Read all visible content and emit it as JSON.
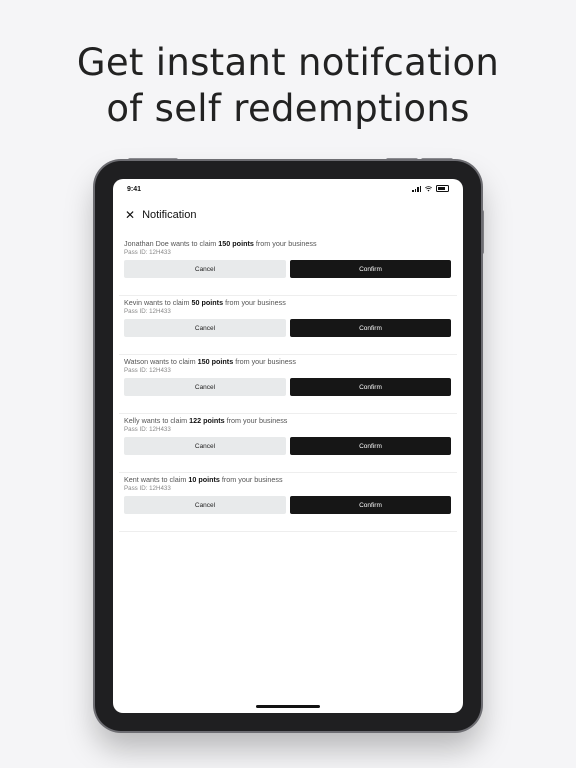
{
  "headline": {
    "line1": "Get instant notifcation",
    "line2": "of self redemptions"
  },
  "status_bar": {
    "time": "9:41"
  },
  "nav": {
    "title": "Notification"
  },
  "notifications": [
    {
      "prefix": "Jonathan Doe wants to claim ",
      "points": "150 points",
      "suffix": " from your business",
      "pass": "Pass ID: 12H433",
      "cancel": "Cancel",
      "confirm": "Confirm"
    },
    {
      "prefix": "Kevin wants to claim ",
      "points": "50 points",
      "suffix": " from your business",
      "pass": "Pass ID: 12H433",
      "cancel": "Cancel",
      "confirm": "Confirm"
    },
    {
      "prefix": "Watson wants to claim ",
      "points": "150 points",
      "suffix": " from your business",
      "pass": "Pass ID: 12H433",
      "cancel": "Cancel",
      "confirm": "Confirm"
    },
    {
      "prefix": "Kelly wants to claim ",
      "points": "122 points",
      "suffix": " from your business",
      "pass": "Pass ID: 12H433",
      "cancel": "Cancel",
      "confirm": "Confirm"
    },
    {
      "prefix": "Kent wants to claim ",
      "points": "10 points",
      "suffix": " from your business",
      "pass": "Pass ID: 12H433",
      "cancel": "Cancel",
      "confirm": "Confirm"
    }
  ],
  "icons": {
    "close": "close-icon",
    "signal": "cellular-signal-icon",
    "wifi": "wifi-icon",
    "battery": "battery-icon"
  },
  "colors": {
    "background": "#f5f5f7",
    "device": "#1f1f21",
    "confirm_button": "#161616",
    "cancel_button": "#e8eaeb"
  }
}
